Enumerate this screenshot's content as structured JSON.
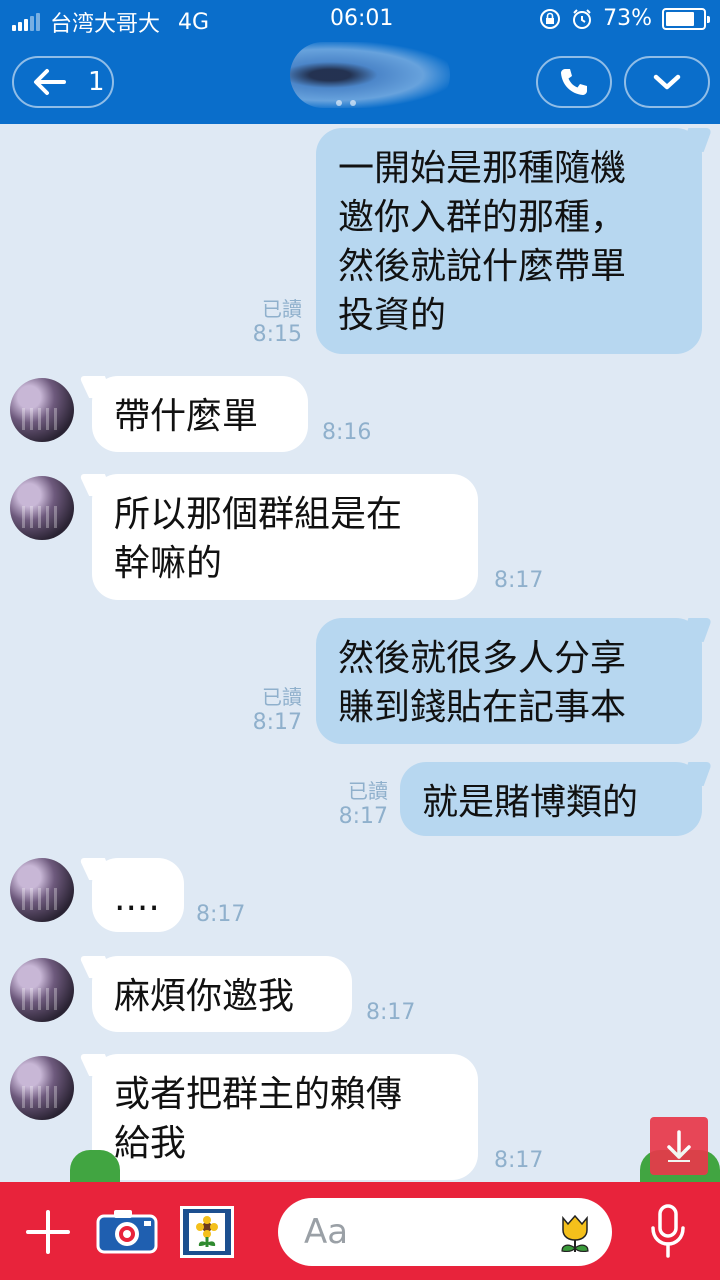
{
  "status_bar": {
    "carrier": "台湾大哥大",
    "network": "4G",
    "time": "06:01",
    "battery": "73%"
  },
  "header": {
    "back_count": "1"
  },
  "messages": [
    {
      "dir": "out",
      "text": "一開始是那種隨機\n邀你入群的那種，\n然後就說什麼帶單\n投資的",
      "read": "已讀",
      "time": "8:15"
    },
    {
      "dir": "in",
      "text": "帶什麼單",
      "time": "8:16"
    },
    {
      "dir": "in",
      "text": "所以那個群組是在\n幹嘛的",
      "time": "8:17"
    },
    {
      "dir": "out",
      "text": "然後就很多人分享\n賺到錢貼在記事本",
      "read": "已讀",
      "time": "8:17"
    },
    {
      "dir": "out",
      "text": "就是賭博類的",
      "read": "已讀",
      "time": "8:17"
    },
    {
      "dir": "in",
      "text": "....",
      "time": "8:17"
    },
    {
      "dir": "in",
      "text": "麻煩你邀我",
      "time": "8:17"
    },
    {
      "dir": "in",
      "text": "或者把群主的賴傳\n給我",
      "time": "8:17"
    }
  ],
  "composer": {
    "placeholder": "Aa"
  },
  "colors": {
    "header": "#0a6ecb",
    "bottom_bar": "#e8233b",
    "chat_bg": "#dfe9f4",
    "outgoing_bubble": "#b7d7f0",
    "incoming_bubble": "#ffffff"
  },
  "icons": [
    "back-arrow-icon",
    "phone-icon",
    "chevron-down-icon",
    "scroll-down-icon",
    "plus-icon",
    "camera-icon",
    "sticker-icon",
    "tulip-icon",
    "microphone-icon"
  ]
}
